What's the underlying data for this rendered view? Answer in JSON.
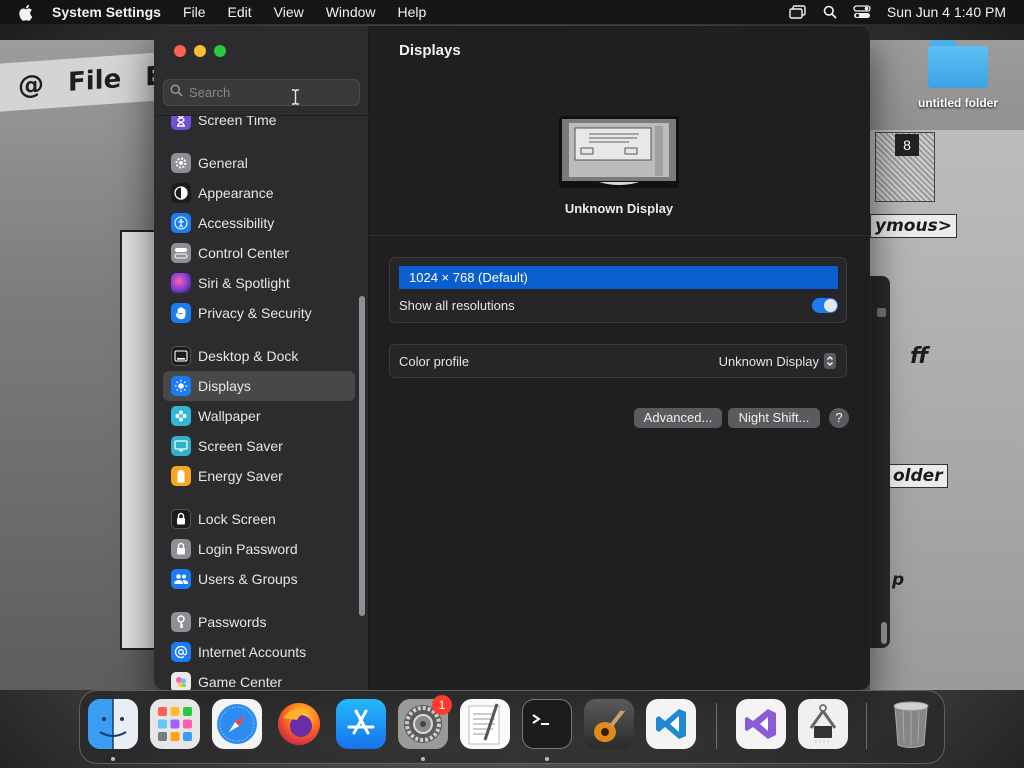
{
  "menubar": {
    "app_name": "System Settings",
    "items": [
      "File",
      "Edit",
      "View",
      "Window",
      "Help"
    ],
    "clock": "Sun Jun 4  1:40 PM"
  },
  "desktop": {
    "folder_label": "untitled folder",
    "crt_menu": [
      "@",
      "File",
      "E"
    ],
    "crt_disk_label": "8",
    "crt_text_1": "ymous>",
    "crt_text_2": "ff",
    "crt_text_3": "older",
    "crt_text_4": "p"
  },
  "sidebar": {
    "search_placeholder": "Search",
    "items": [
      {
        "label": "Screen Time",
        "icon": "hourglass-icon",
        "color": "#6e4fd6"
      },
      {
        "label": "General",
        "icon": "gear-icon",
        "color": "#8e8e93"
      },
      {
        "label": "Appearance",
        "icon": "appearance-icon",
        "color": "#1c1c1e"
      },
      {
        "label": "Accessibility",
        "icon": "accessibility-icon",
        "color": "#1a7cf2"
      },
      {
        "label": "Control Center",
        "icon": "control-center-icon",
        "color": "#8e8e93"
      },
      {
        "label": "Siri & Spotlight",
        "icon": "siri-icon",
        "color": "#c33bb0"
      },
      {
        "label": "Privacy & Security",
        "icon": "hand-icon",
        "color": "#1a7cf2"
      },
      {
        "label": "Desktop & Dock",
        "icon": "dock-icon",
        "color": "#1c1c1e"
      },
      {
        "label": "Displays",
        "icon": "sun-icon",
        "color": "#1a7cf2"
      },
      {
        "label": "Wallpaper",
        "icon": "wallpaper-icon",
        "color": "#31b7d8"
      },
      {
        "label": "Screen Saver",
        "icon": "screen-saver-icon",
        "color": "#2fb3c9"
      },
      {
        "label": "Energy Saver",
        "icon": "battery-icon",
        "color": "#f5a623"
      },
      {
        "label": "Lock Screen",
        "icon": "lock-icon",
        "color": "#1c1c1e"
      },
      {
        "label": "Login Password",
        "icon": "padlock-icon",
        "color": "#8e8e93"
      },
      {
        "label": "Users & Groups",
        "icon": "users-icon",
        "color": "#1a7cf2"
      },
      {
        "label": "Passwords",
        "icon": "key-icon",
        "color": "#8e8e93"
      },
      {
        "label": "Internet Accounts",
        "icon": "at-icon",
        "color": "#1a7cf2"
      },
      {
        "label": "Game Center",
        "icon": "game-center-icon",
        "color": "#e9e9e9"
      }
    ]
  },
  "main": {
    "title": "Displays",
    "display_name": "Unknown Display",
    "resolution": "1024 × 768 (Default)",
    "show_all": "Show all resolutions",
    "show_all_on": true,
    "color_profile_label": "Color profile",
    "color_profile_value": "Unknown Display",
    "advanced_label": "Advanced...",
    "night_shift_label": "Night Shift...",
    "help_label": "?"
  },
  "dock": {
    "settings_badge": "1",
    "apps": [
      "finder",
      "launchpad",
      "safari",
      "firefox",
      "app-store",
      "system-settings",
      "textedit",
      "terminal",
      "garageband",
      "vscode",
      "visual-studio",
      "system-information",
      "trash"
    ]
  }
}
